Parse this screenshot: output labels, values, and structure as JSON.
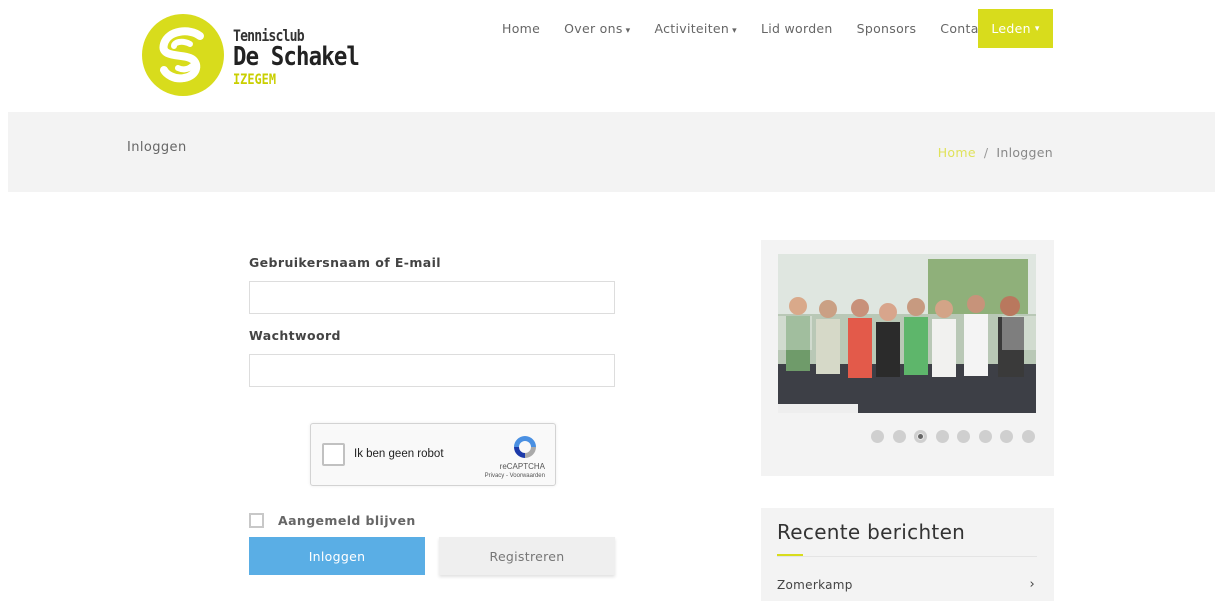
{
  "header": {
    "logo": {
      "line1": "Tennisclub",
      "line2": "De Schakel",
      "line3": "IZEGEM",
      "color": "#d8dc1c"
    },
    "nav": [
      {
        "label": "Home",
        "has_caret": false
      },
      {
        "label": "Over ons",
        "has_caret": true
      },
      {
        "label": "Activiteiten",
        "has_caret": true
      },
      {
        "label": "Lid worden",
        "has_caret": false
      },
      {
        "label": "Sponsors",
        "has_caret": false
      },
      {
        "label": "Contact",
        "has_caret": false
      }
    ],
    "leden_label": "Leden",
    "caret": "▾"
  },
  "banner": {
    "title": "Inloggen",
    "breadcrumb_home": "Home",
    "breadcrumb_sep": "/",
    "breadcrumb_current": "Inloggen"
  },
  "form": {
    "username_label": "Gebruikersnaam of E-mail",
    "username_value": "",
    "password_label": "Wachtwoord",
    "password_value": "",
    "captcha_label": "Ik ben geen robot",
    "captcha_brand": "reCAPTCHA",
    "captcha_links": "Privacy - Voorwaarden",
    "remember_label": "Aangemeld blijven",
    "login_button": "Inloggen",
    "register_button": "Registreren"
  },
  "sidebar": {
    "slider_dots": 8,
    "active_dot": 3,
    "posts_title": "Recente berichten",
    "posts": [
      {
        "label": "Zomerkamp"
      }
    ],
    "post_arrow": "›"
  },
  "colors": {
    "accent": "#d8dc1c",
    "login_button": "#5aaee5",
    "band": "#f3f3f3"
  }
}
